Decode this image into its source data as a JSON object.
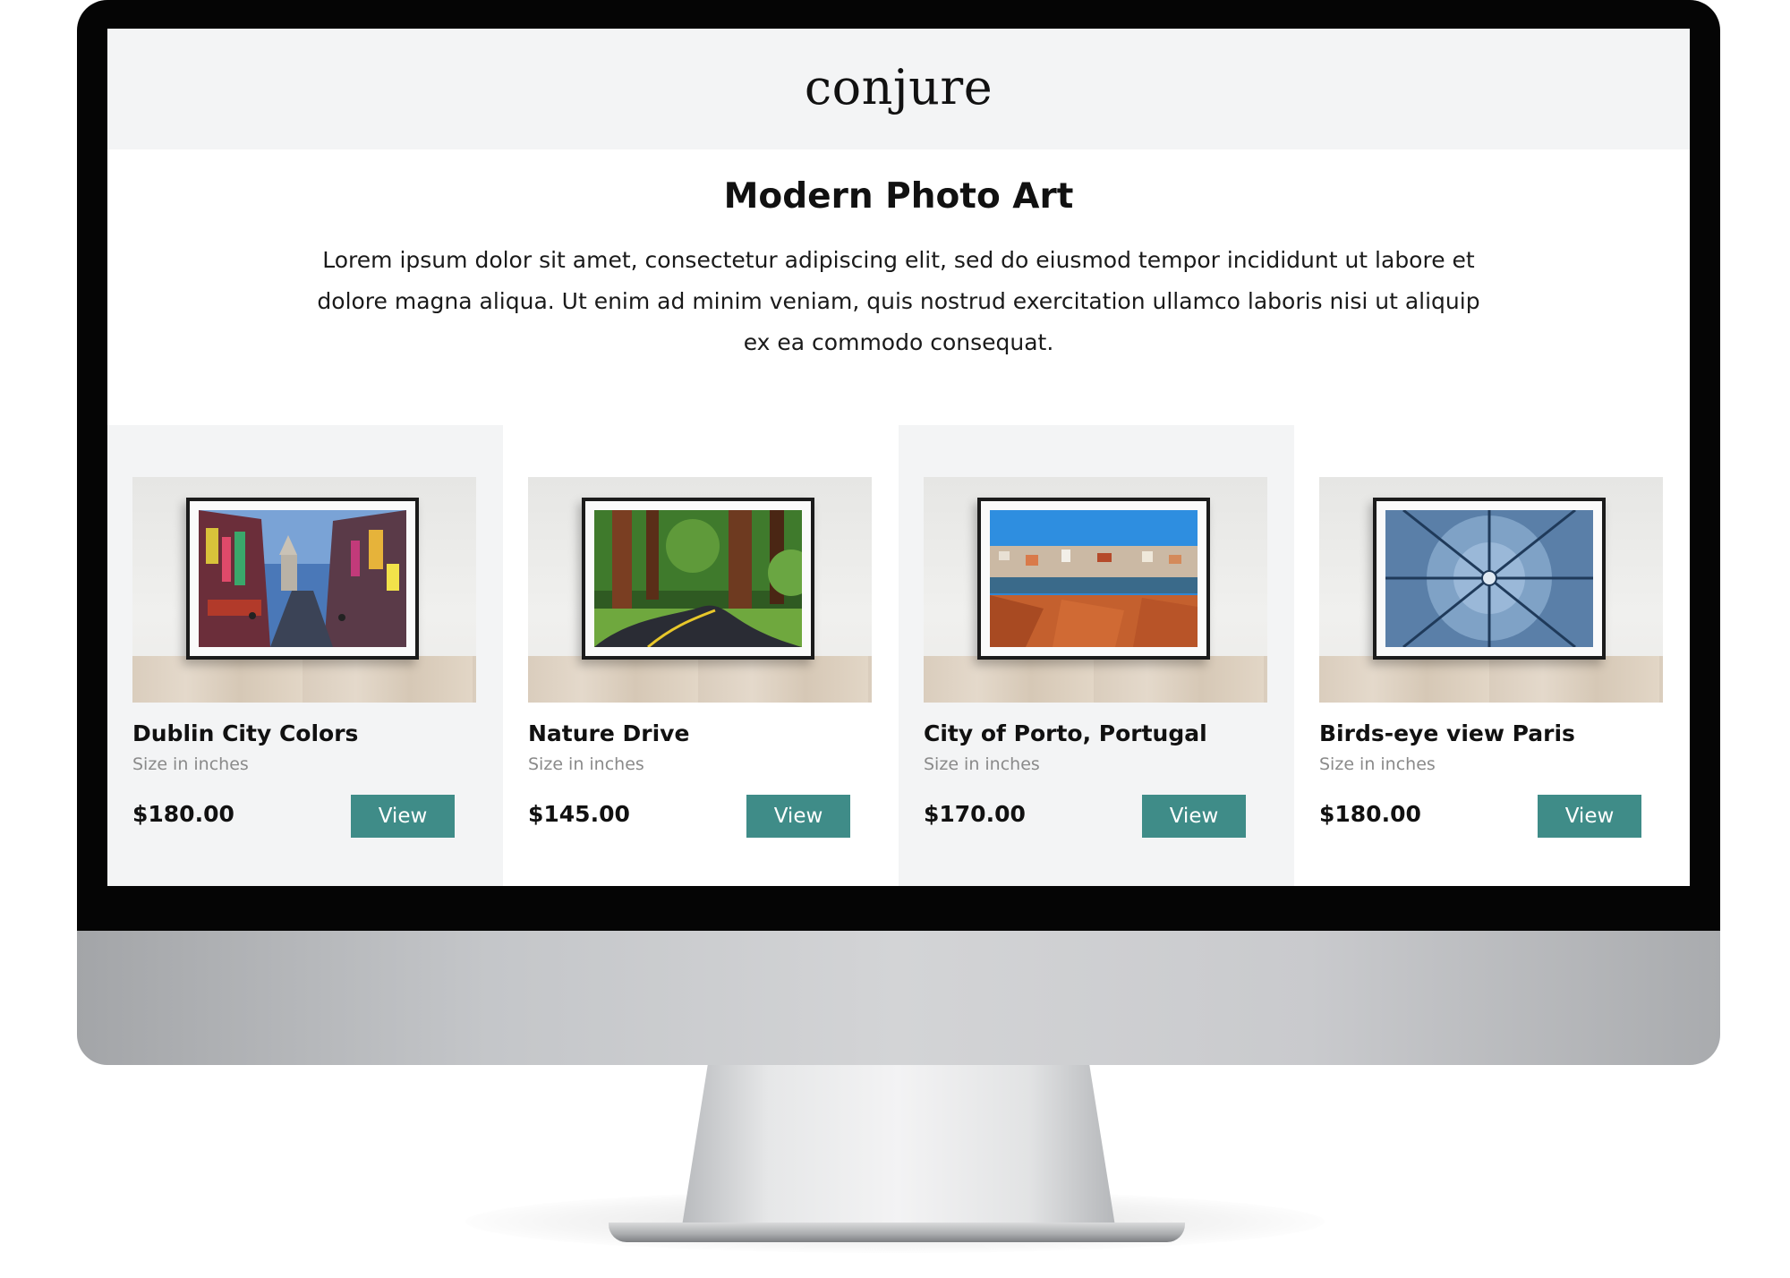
{
  "site": {
    "logo": "conjure"
  },
  "intro": {
    "title": "Modern Photo Art",
    "text": "Lorem ipsum dolor sit amet, consectetur adipiscing elit, sed do eiusmod tempor incididunt ut labore et dolore magna aliqua. Ut enim ad minim veniam, quis nostrud exercitation ullamco laboris nisi ut aliquip ex ea commodo consequat."
  },
  "products": [
    {
      "name": "Dublin City Colors",
      "size_label": "Size in inches",
      "price": "$180.00",
      "button": "View"
    },
    {
      "name": "Nature Drive",
      "size_label": "Size in inches",
      "price": "$145.00",
      "button": "View"
    },
    {
      "name": "City of Porto, Portugal",
      "size_label": "Size in inches",
      "price": "$170.00",
      "button": "View"
    },
    {
      "name": "Birds-eye view Paris",
      "size_label": "Size in inches",
      "price": "$180.00",
      "button": "View"
    }
  ],
  "colors": {
    "accent": "#3f8c88",
    "header_bg": "#f3f4f5",
    "bezel": "#050505"
  }
}
